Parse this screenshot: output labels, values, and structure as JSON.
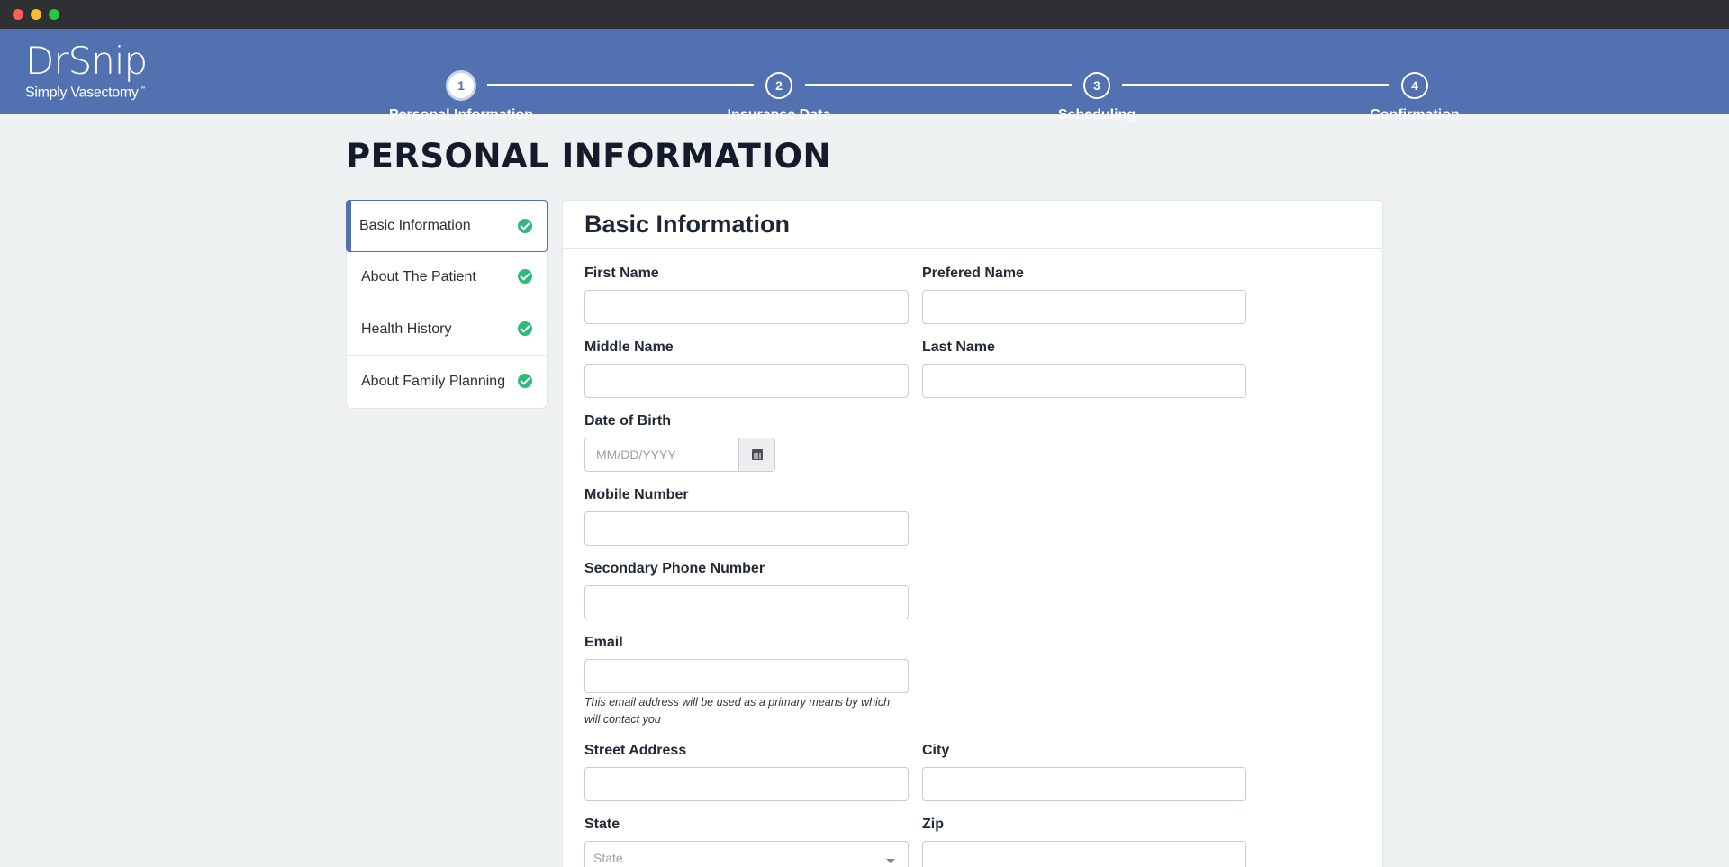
{
  "brand": {
    "name": "DrSnip",
    "tagline": "Simply Vasectomy",
    "tm": "™"
  },
  "colors": {
    "header": "#5271b0",
    "accent": "#5271b0",
    "check": "#31b97d",
    "background": "#eef1f2"
  },
  "steps": [
    {
      "number": "1",
      "label": "Personal Information",
      "active": true
    },
    {
      "number": "2",
      "label": "Insurance Data"
    },
    {
      "number": "3",
      "label": "Scheduling"
    },
    {
      "number": "4",
      "label": "Confirmation"
    }
  ],
  "page_title": "PERSONAL INFORMATION",
  "sidebar": {
    "items": [
      {
        "label": "Basic Information",
        "icon": "check-circle-icon",
        "complete": true,
        "active": true
      },
      {
        "label": "About The Patient",
        "icon": "check-circle-icon",
        "complete": true
      },
      {
        "label": "Health History",
        "icon": "check-circle-icon",
        "complete": true
      },
      {
        "label": "About Family Planning",
        "icon": "check-circle-icon",
        "complete": true
      }
    ]
  },
  "form": {
    "title": "Basic Information",
    "fields": {
      "first_name": {
        "label": "First Name",
        "value": ""
      },
      "preferred_name": {
        "label": "Prefered Name",
        "value": ""
      },
      "middle_name": {
        "label": "Middle Name",
        "value": ""
      },
      "last_name": {
        "label": "Last Name",
        "value": ""
      },
      "dob": {
        "label": "Date of Birth",
        "placeholder": "MM/DD/YYYY",
        "icon": "calendar-icon"
      },
      "mobile": {
        "label": "Mobile Number",
        "value": ""
      },
      "secondary_phone": {
        "label": "Secondary Phone Number",
        "value": ""
      },
      "email": {
        "label": "Email",
        "value": "",
        "help": "This email address will be used as a primary means by which will contact you"
      },
      "street": {
        "label": "Street Address",
        "value": ""
      },
      "city": {
        "label": "City",
        "value": ""
      },
      "state": {
        "label": "State",
        "placeholder": "State",
        "icon": "chevron-down-icon"
      },
      "zip": {
        "label": "Zip",
        "value": ""
      }
    }
  }
}
